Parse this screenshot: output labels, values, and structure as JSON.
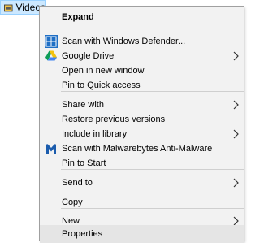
{
  "explorer": {
    "selected_item": "Videos"
  },
  "menu": {
    "expand": "Expand",
    "scan_defender": "Scan with Windows Defender...",
    "google_drive": "Google Drive",
    "open_new_window": "Open in new window",
    "pin_quick_access": "Pin to Quick access",
    "share_with": "Share with",
    "restore_versions": "Restore previous versions",
    "include_library": "Include in library",
    "scan_malwarebytes": "Scan with Malwarebytes Anti-Malware",
    "pin_start": "Pin to Start",
    "send_to": "Send to",
    "copy": "Copy",
    "new": "New",
    "properties": "Properties"
  },
  "icons": {
    "defender": "windows-defender-icon",
    "google_drive": "google-drive-icon",
    "malwarebytes": "malwarebytes-icon",
    "folder": "folder-videos-icon",
    "submenu": "chevron-right-icon"
  },
  "colors": {
    "menu_background": "#f2f2f2",
    "hover_background": "#e5e5e5",
    "selection_background": "#cce8ff",
    "defender_blue": "#1f6fc5",
    "malwarebytes_blue": "#1b5cad"
  }
}
